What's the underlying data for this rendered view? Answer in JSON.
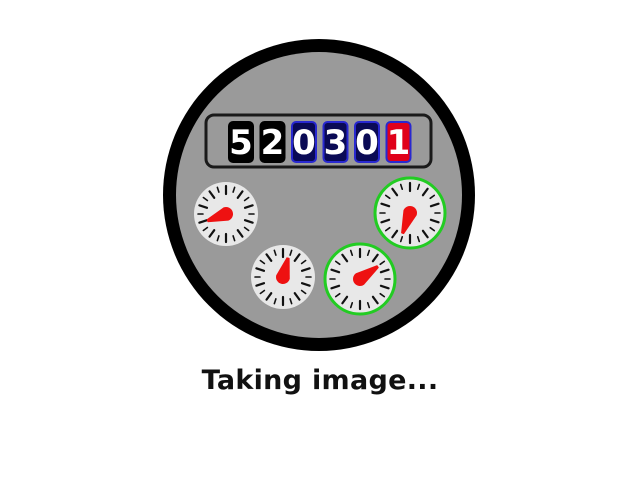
{
  "status": {
    "text": "Taking image..."
  },
  "odometer": {
    "digits": [
      {
        "value": "5",
        "fill": "#000000",
        "border": "#000000"
      },
      {
        "value": "2",
        "fill": "#000000",
        "border": "#000000"
      },
      {
        "value": "0",
        "fill": "#0a0a55",
        "border": "#2828d0"
      },
      {
        "value": "3",
        "fill": "#0a0a55",
        "border": "#2828d0"
      },
      {
        "value": "0",
        "fill": "#0a0a55",
        "border": "#2828d0"
      },
      {
        "value": "1",
        "fill": "#e0001a",
        "border": "#2828d0"
      }
    ]
  },
  "dials": [
    {
      "name": "dial-1",
      "highlighted": false,
      "needle_angle_deg": -110
    },
    {
      "name": "dial-2",
      "highlighted": false,
      "needle_angle_deg": 15
    },
    {
      "name": "dial-3",
      "highlighted": true,
      "needle_angle_deg": -160
    },
    {
      "name": "dial-4",
      "highlighted": true,
      "needle_angle_deg": 55
    }
  ],
  "colors": {
    "meter_rim": "#000000",
    "meter_face": "#9a9a9a",
    "dial_face": "#e8e8e8",
    "needle": "#ee1111",
    "highlight_ring": "#22cc22",
    "tick": "#111111"
  },
  "icons": {
    "meter": "water-meter-icon"
  }
}
